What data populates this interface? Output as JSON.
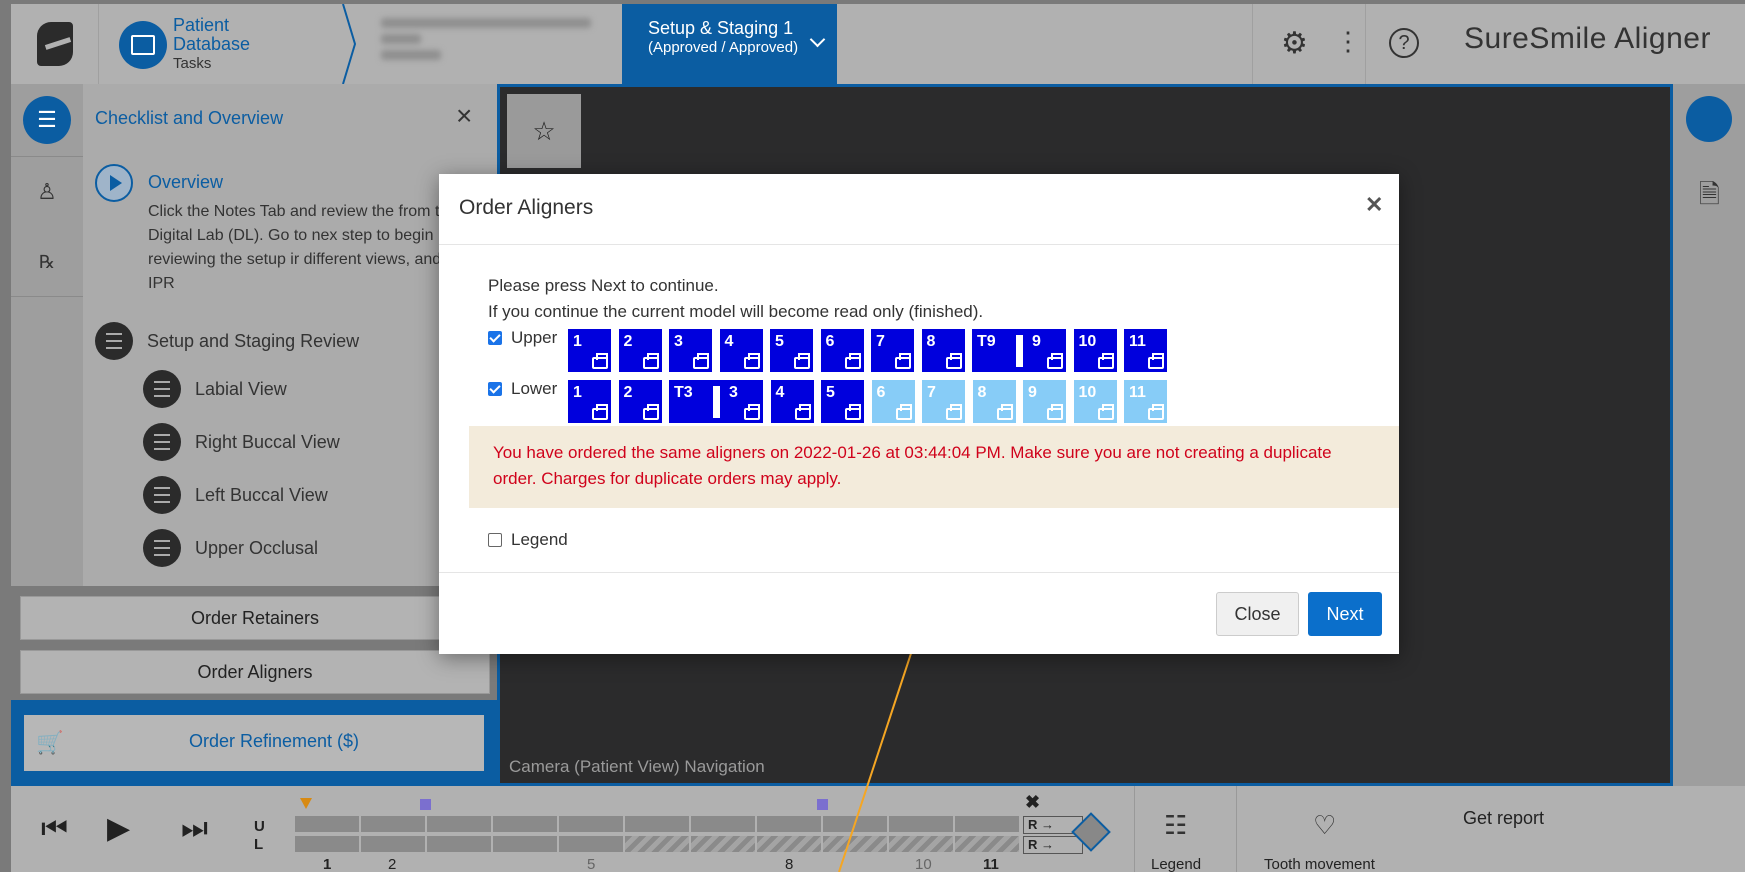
{
  "header": {
    "patient_db_title_1": "Patient",
    "patient_db_title_2": "Database",
    "patient_db_sub": "Tasks",
    "stage_title": "Setup & Staging 1",
    "stage_sub": "(Approved / Approved)",
    "brand": "SureSmile Aligner"
  },
  "panel": {
    "title": "Checklist and Overview",
    "overview_title": "Overview",
    "overview_desc": "Click the Notes Tab and review the from the Digital Lab (DL). Go to nex step to begin reviewing the setup ir different views, and review IPR",
    "steps": [
      "Setup and Staging Review",
      "Labial View",
      "Right Buccal View",
      "Left Buccal View",
      "Upper Occlusal"
    ],
    "order_retainers": "Order Retainers",
    "order_aligners": "Order Aligners",
    "order_refinement": "Order Refinement ($)"
  },
  "viewport": {
    "camera_label": "Camera (Patient View) Navigation"
  },
  "bottombar": {
    "u_label": "U",
    "l_label": "L",
    "ticks": [
      "1",
      "2",
      "5",
      "8",
      "10",
      "11"
    ],
    "r_label": "R →",
    "legend": "Legend",
    "tooth_movement": "Tooth movement",
    "get_report": "Get report"
  },
  "modal": {
    "title": "Order Aligners",
    "msg1": "Please press Next to continue.",
    "msg2": "If you continue the current model will become read only (finished).",
    "upper_label": "Upper",
    "lower_label": "Lower",
    "upper_aligners": [
      "1",
      "2",
      "3",
      "4",
      "5",
      "6",
      "7",
      "8",
      "T9",
      "9",
      "10",
      "11"
    ],
    "lower_aligners": [
      "1",
      "2",
      "T3",
      "3",
      "4",
      "5",
      "6",
      "7",
      "8",
      "9",
      "10",
      "11"
    ],
    "lower_ordered_count": 6,
    "warning": "You have ordered the same aligners on 2022-01-26 at 03:44:04 PM. Make sure you are not creating a duplicate order. Charges for duplicate orders may apply.",
    "legend_label": "Legend",
    "close_label": "Close",
    "next_label": "Next"
  },
  "colors": {
    "accent": "#0b5da2",
    "aligner_ordered": "#0000dd",
    "aligner_not_ordered": "#87ccf7",
    "warning_text": "#d0021b",
    "warning_bg": "#f3ebdb"
  },
  "icons": [
    "logo-s",
    "monitor-icon",
    "gear-icon",
    "kebab-icon",
    "help-icon",
    "checklist-icon",
    "patient-icon",
    "rx-icon",
    "star-icon",
    "camera-icon",
    "document-icon",
    "play-icon",
    "skip-back-icon",
    "skip-forward-icon",
    "legend-icon",
    "tooth-icon",
    "printer-icon",
    "cart-icon"
  ]
}
